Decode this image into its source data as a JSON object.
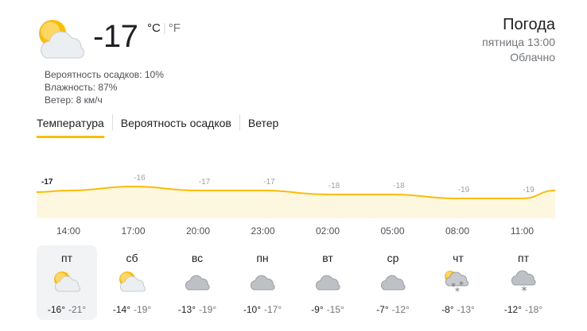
{
  "current": {
    "icon": "partly-cloudy-icon",
    "temperature": "-17",
    "unit_c": "°C",
    "unit_f": "°F",
    "details": {
      "precipitation": "Вероятность осадков: 10%",
      "humidity": "Влажность: 87%",
      "wind": "Ветер: 8 км/ч"
    }
  },
  "header": {
    "title": "Погода",
    "datetime": "пятница 13:00",
    "condition": "Облачно"
  },
  "tabs": [
    "Температура",
    "Вероятность осадков",
    "Ветер"
  ],
  "active_tab": "Температура",
  "colors": {
    "accent": "#fbbc04",
    "fill": "#fef7e0",
    "selected_day": "#f1f3f4"
  },
  "chart_data": {
    "type": "area",
    "labels": [
      "-17",
      "-16",
      "-17",
      "-17",
      "-18",
      "-18",
      "-19",
      "-19"
    ],
    "values": [
      -17,
      -16,
      -17,
      -17,
      -18,
      -18,
      -19,
      -19
    ],
    "x": [
      "14:00",
      "17:00",
      "20:00",
      "23:00",
      "02:00",
      "05:00",
      "08:00",
      "11:00"
    ]
  },
  "days": [
    {
      "name": "пт",
      "icon": "partly-cloudy-icon",
      "hi": "-16°",
      "lo": "-21°",
      "selected": true
    },
    {
      "name": "сб",
      "icon": "partly-cloudy-icon",
      "hi": "-14°",
      "lo": "-19°",
      "selected": false
    },
    {
      "name": "вс",
      "icon": "cloud-icon",
      "hi": "-13°",
      "lo": "-19°",
      "selected": false
    },
    {
      "name": "пн",
      "icon": "cloud-icon",
      "hi": "-10°",
      "lo": "-17°",
      "selected": false
    },
    {
      "name": "вт",
      "icon": "cloud-icon",
      "hi": "-9°",
      "lo": "-15°",
      "selected": false
    },
    {
      "name": "ср",
      "icon": "cloud-icon",
      "hi": "-7°",
      "lo": "-12°",
      "selected": false
    },
    {
      "name": "чт",
      "icon": "snow-partly-cloudy-icon",
      "hi": "-8°",
      "lo": "-13°",
      "selected": false
    },
    {
      "name": "пт",
      "icon": "snow-cloud-icon",
      "hi": "-12°",
      "lo": "-18°",
      "selected": false
    }
  ]
}
